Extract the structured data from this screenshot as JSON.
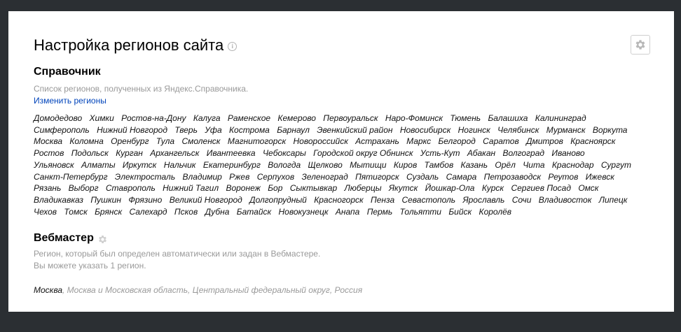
{
  "page": {
    "title": "Настройка регионов сайта",
    "info_icon": "info-icon",
    "settings_icon": "gear-icon"
  },
  "directory": {
    "title": "Справочник",
    "description": "Список регионов, полученных из Яндекс.Справочника.",
    "change_link": "Изменить регионы",
    "regions": [
      "Домодедово",
      "Химки",
      "Ростов-на-Дону",
      "Калуга",
      "Раменское",
      "Кемерово",
      "Первоуральск",
      "Наро-Фоминск",
      "Тюмень",
      "Балашиха",
      "Калининград",
      "Симферополь",
      "Нижний Новгород",
      "Тверь",
      "Уфа",
      "Кострома",
      "Барнаул",
      "Эвенкийский район",
      "Новосибирск",
      "Ногинск",
      "Челябинск",
      "Мурманск",
      "Воркута",
      "Москва",
      "Коломна",
      "Оренбург",
      "Тула",
      "Смоленск",
      "Магнитогорск",
      "Новороссийск",
      "Астрахань",
      "Маркс",
      "Белгород",
      "Саратов",
      "Дмитров",
      "Красноярск",
      "Ростов",
      "Подольск",
      "Курган",
      "Архангельск",
      "Ивантеевка",
      "Чебоксары",
      "Городской округ Обнинск",
      "Усть-Кут",
      "Абакан",
      "Волгоград",
      "Иваново",
      "Ульяновск",
      "Алматы",
      "Иркутск",
      "Нальчик",
      "Екатеринбург",
      "Вологда",
      "Щелково",
      "Мытищи",
      "Киров",
      "Тамбов",
      "Казань",
      "Орёл",
      "Чита",
      "Краснодар",
      "Сургут",
      "Санкт-Петербург",
      "Электросталь",
      "Владимир",
      "Ржев",
      "Серпухов",
      "Зеленоград",
      "Пятигорск",
      "Суздаль",
      "Самара",
      "Петрозаводск",
      "Реутов",
      "Ижевск",
      "Рязань",
      "Выборг",
      "Ставрополь",
      "Нижний Тагил",
      "Воронеж",
      "Бор",
      "Сыктывкар",
      "Люберцы",
      "Якутск",
      "Йошкар-Ола",
      "Курск",
      "Сергиев Посад",
      "Омск",
      "Владикавказ",
      "Пушкин",
      "Фрязино",
      "Великий Новгород",
      "Долгопрудный",
      "Красногорск",
      "Пенза",
      "Севастополь",
      "Ярославль",
      "Сочи",
      "Владивосток",
      "Липецк",
      "Чехов",
      "Томск",
      "Брянск",
      "Салехард",
      "Псков",
      "Дубна",
      "Батайск",
      "Новокузнецк",
      "Анапа",
      "Пермь",
      "Тольятти",
      "Бийск",
      "Королёв"
    ]
  },
  "webmaster": {
    "title": "Вебмастер",
    "icon": "gear-icon",
    "description_line1": "Регион, который был определен автоматически или задан в Вебмастере.",
    "description_line2": "Вы можете указать 1 регион.",
    "region_main": "Москва",
    "region_rest": ", Москва и Московская область, Центральный федеральный округ, Россия"
  }
}
